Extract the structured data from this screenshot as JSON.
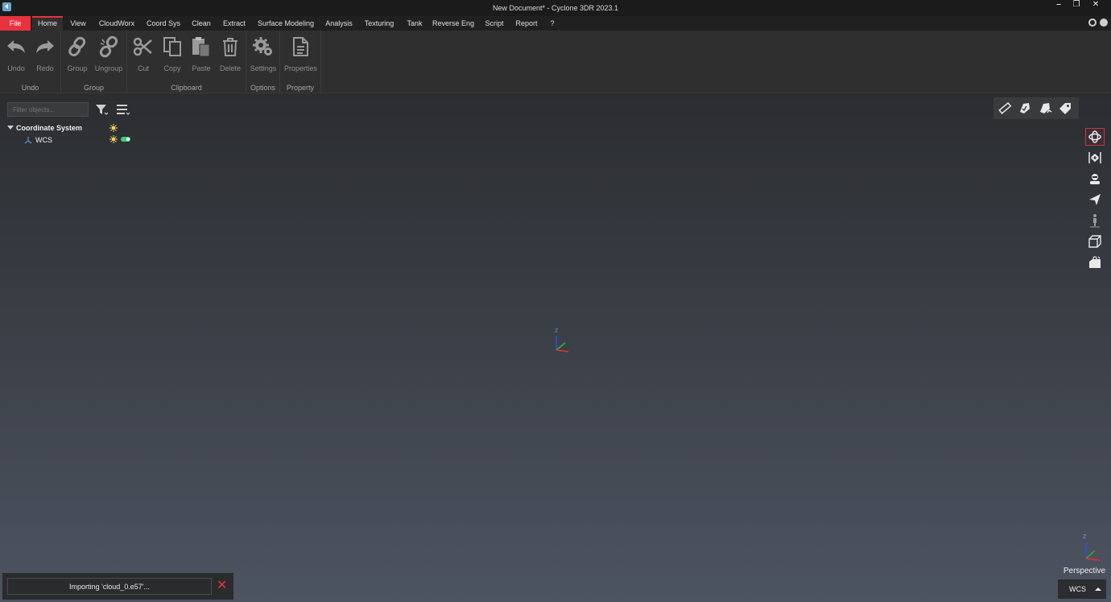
{
  "window": {
    "title": "New Document* - Cyclone 3DR 2023.1",
    "minimize": "–",
    "restore": "❐",
    "close": "✕"
  },
  "menu": {
    "file": "File",
    "items": [
      "Home",
      "View",
      "CloudWorx",
      "Coord Sys",
      "Clean",
      "Extract",
      "Surface Modeling",
      "Analysis",
      "Texturing",
      "Tank",
      "Reverse Eng",
      "Script",
      "Report",
      "?"
    ],
    "active": "Home"
  },
  "ribbon": {
    "groups": {
      "undo": "Undo",
      "group": "Group",
      "clipboard": "Clipboard",
      "options": "Options",
      "property": "Property"
    },
    "buttons": {
      "undo": "Undo",
      "redo": "Redo",
      "group": "Group",
      "ungroup": "Ungroup",
      "cut": "Cut",
      "copy": "Copy",
      "paste": "Paste",
      "delete": "Delete",
      "settings": "Settings",
      "properties": "Properties"
    }
  },
  "tree": {
    "filter_placeholder": "Filter objects...",
    "root": "Coordinate System",
    "child": "WCS"
  },
  "viewport": {
    "axis_label": "Z",
    "projection": "Perspective",
    "coord_system": "WCS"
  },
  "status": {
    "message": "Importing 'cloud_0.e57'...",
    "cancel": "✕"
  },
  "colors": {
    "accent": "#e8333f",
    "toggle_on": "#3dd17a",
    "axis_x": "#e03030",
    "axis_y": "#30b040",
    "axis_z": "#3050e0"
  }
}
